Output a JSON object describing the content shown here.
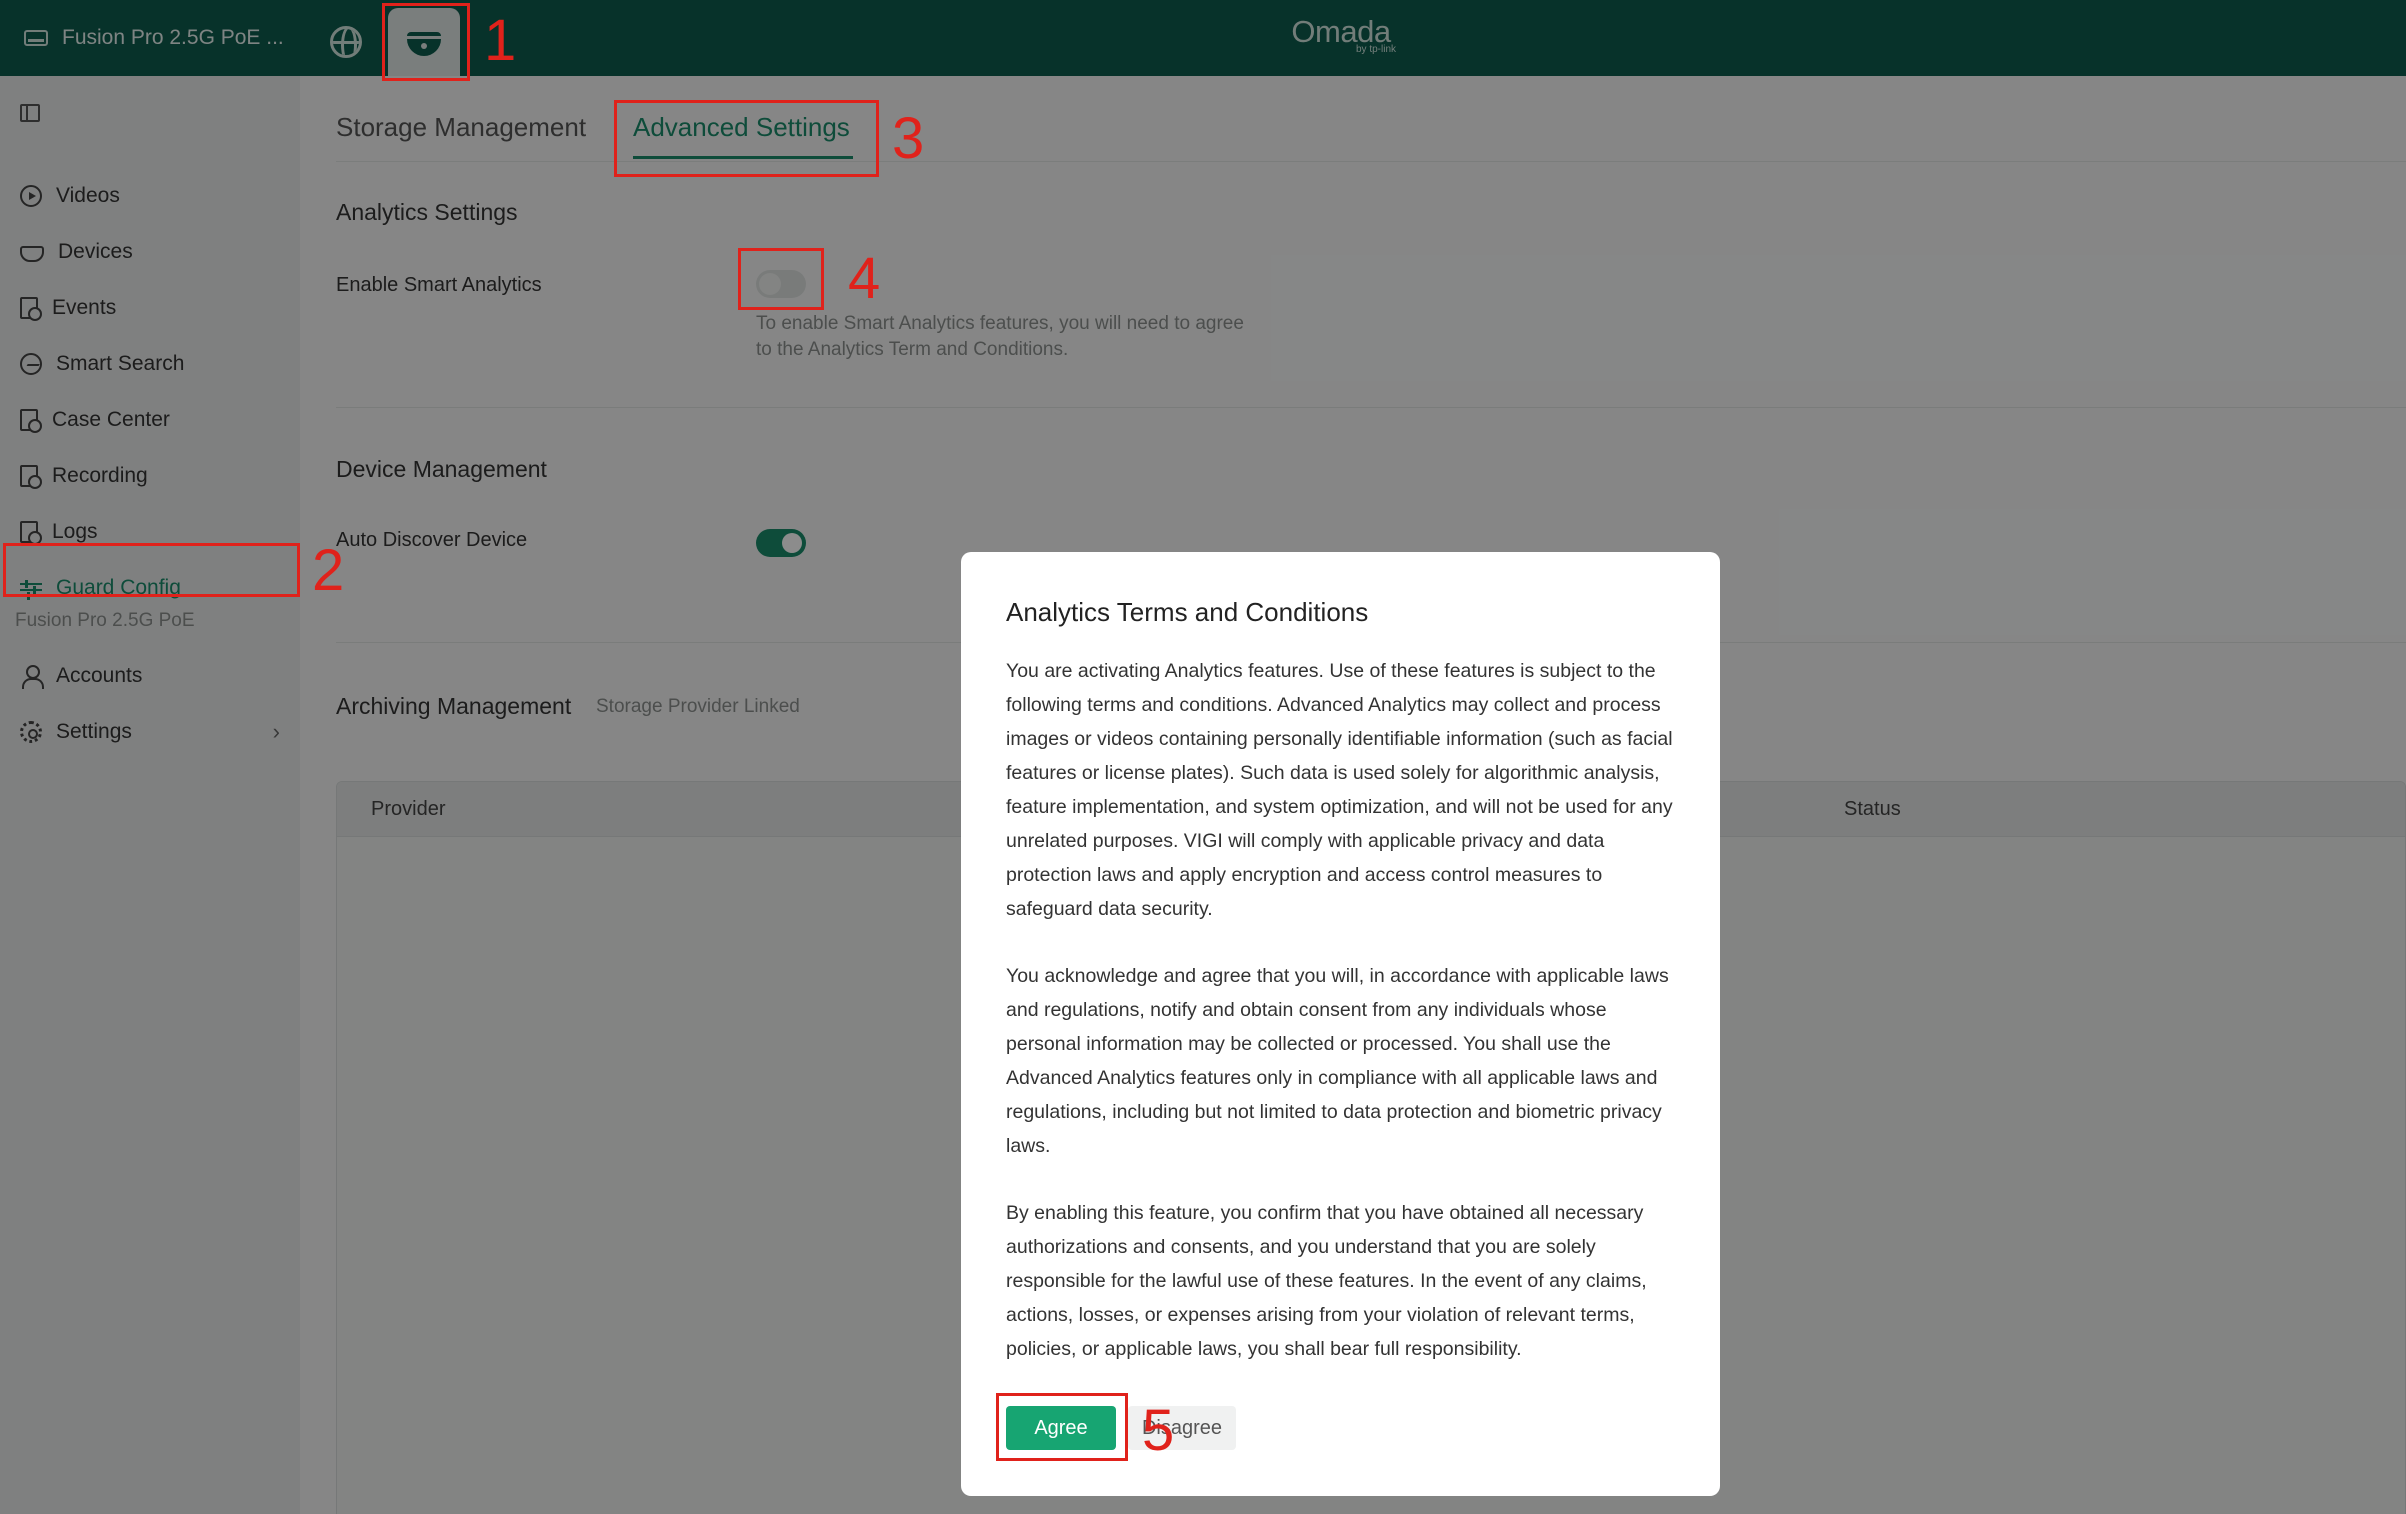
{
  "topbar": {
    "site_name": "Fusion Pro 2.5G PoE ...",
    "brand_name": "Omada",
    "brand_sub": "by tp-link"
  },
  "sidebar": {
    "items": [
      {
        "label": "Videos",
        "icon": "play-circle-icon"
      },
      {
        "label": "Devices",
        "icon": "camera-icon"
      },
      {
        "label": "Events",
        "icon": "event-search-icon"
      },
      {
        "label": "Smart Search",
        "icon": "smart-search-icon"
      },
      {
        "label": "Case Center",
        "icon": "case-icon"
      },
      {
        "label": "Recording",
        "icon": "recording-icon"
      },
      {
        "label": "Logs",
        "icon": "logs-icon"
      },
      {
        "label": "Guard Config",
        "icon": "sliders-icon",
        "active": true
      }
    ],
    "site_label": "Fusion Pro 2.5G PoE",
    "bottom_items": [
      {
        "label": "Accounts",
        "icon": "user-icon"
      },
      {
        "label": "Settings",
        "icon": "gear-icon"
      }
    ],
    "chevron": "›"
  },
  "tabs": [
    {
      "label": "Storage Management",
      "active": false
    },
    {
      "label": "Advanced Settings",
      "active": true
    }
  ],
  "analytics": {
    "title": "Analytics Settings",
    "enable_label": "Enable Smart Analytics",
    "enabled": false,
    "hint": "To enable Smart Analytics features, you will need to agree to the Analytics Term and Conditions."
  },
  "device_mgmt": {
    "title": "Device Management",
    "auto_discover_label": "Auto Discover Device",
    "auto_discover_enabled": true
  },
  "archiving": {
    "title": "Archiving Management",
    "subtitle": "Storage Provider Linked",
    "columns": [
      "Provider",
      "Status"
    ]
  },
  "modal": {
    "title": "Analytics Terms and Conditions",
    "paragraphs": [
      "You are activating Analytics features. Use of these features is subject to the following terms and conditions. Advanced Analytics may collect and process images or videos containing personally identifiable information (such as facial features or license plates). Such data is used solely for algorithmic analysis, feature implementation, and system optimization, and will not be used for any unrelated purposes. VIGI will comply with applicable privacy and data protection laws and apply encryption and access control measures to safeguard data security.",
      "You acknowledge and agree that you will, in accordance with applicable laws and regulations, notify and obtain consent from any individuals whose personal information may be collected or processed. You shall use the Advanced Analytics features only in compliance with all applicable laws and regulations, including but not limited to data protection and biometric privacy laws.",
      "By enabling this feature, you confirm that you have obtained all necessary authorizations and consents, and you understand that you are solely responsible for the lawful use of these features. In the event of any claims, actions, losses, or expenses arising from your violation of relevant terms, policies, or applicable laws, you shall bear full responsibility."
    ],
    "agree_label": "Agree",
    "disagree_label": "Disagree"
  },
  "annotations": [
    "1",
    "2",
    "3",
    "4",
    "5"
  ],
  "colors": {
    "topbar": "#0e5c4e",
    "accent": "#1a8a6a",
    "agree_button": "#17a572",
    "annotation": "#e0221b"
  }
}
